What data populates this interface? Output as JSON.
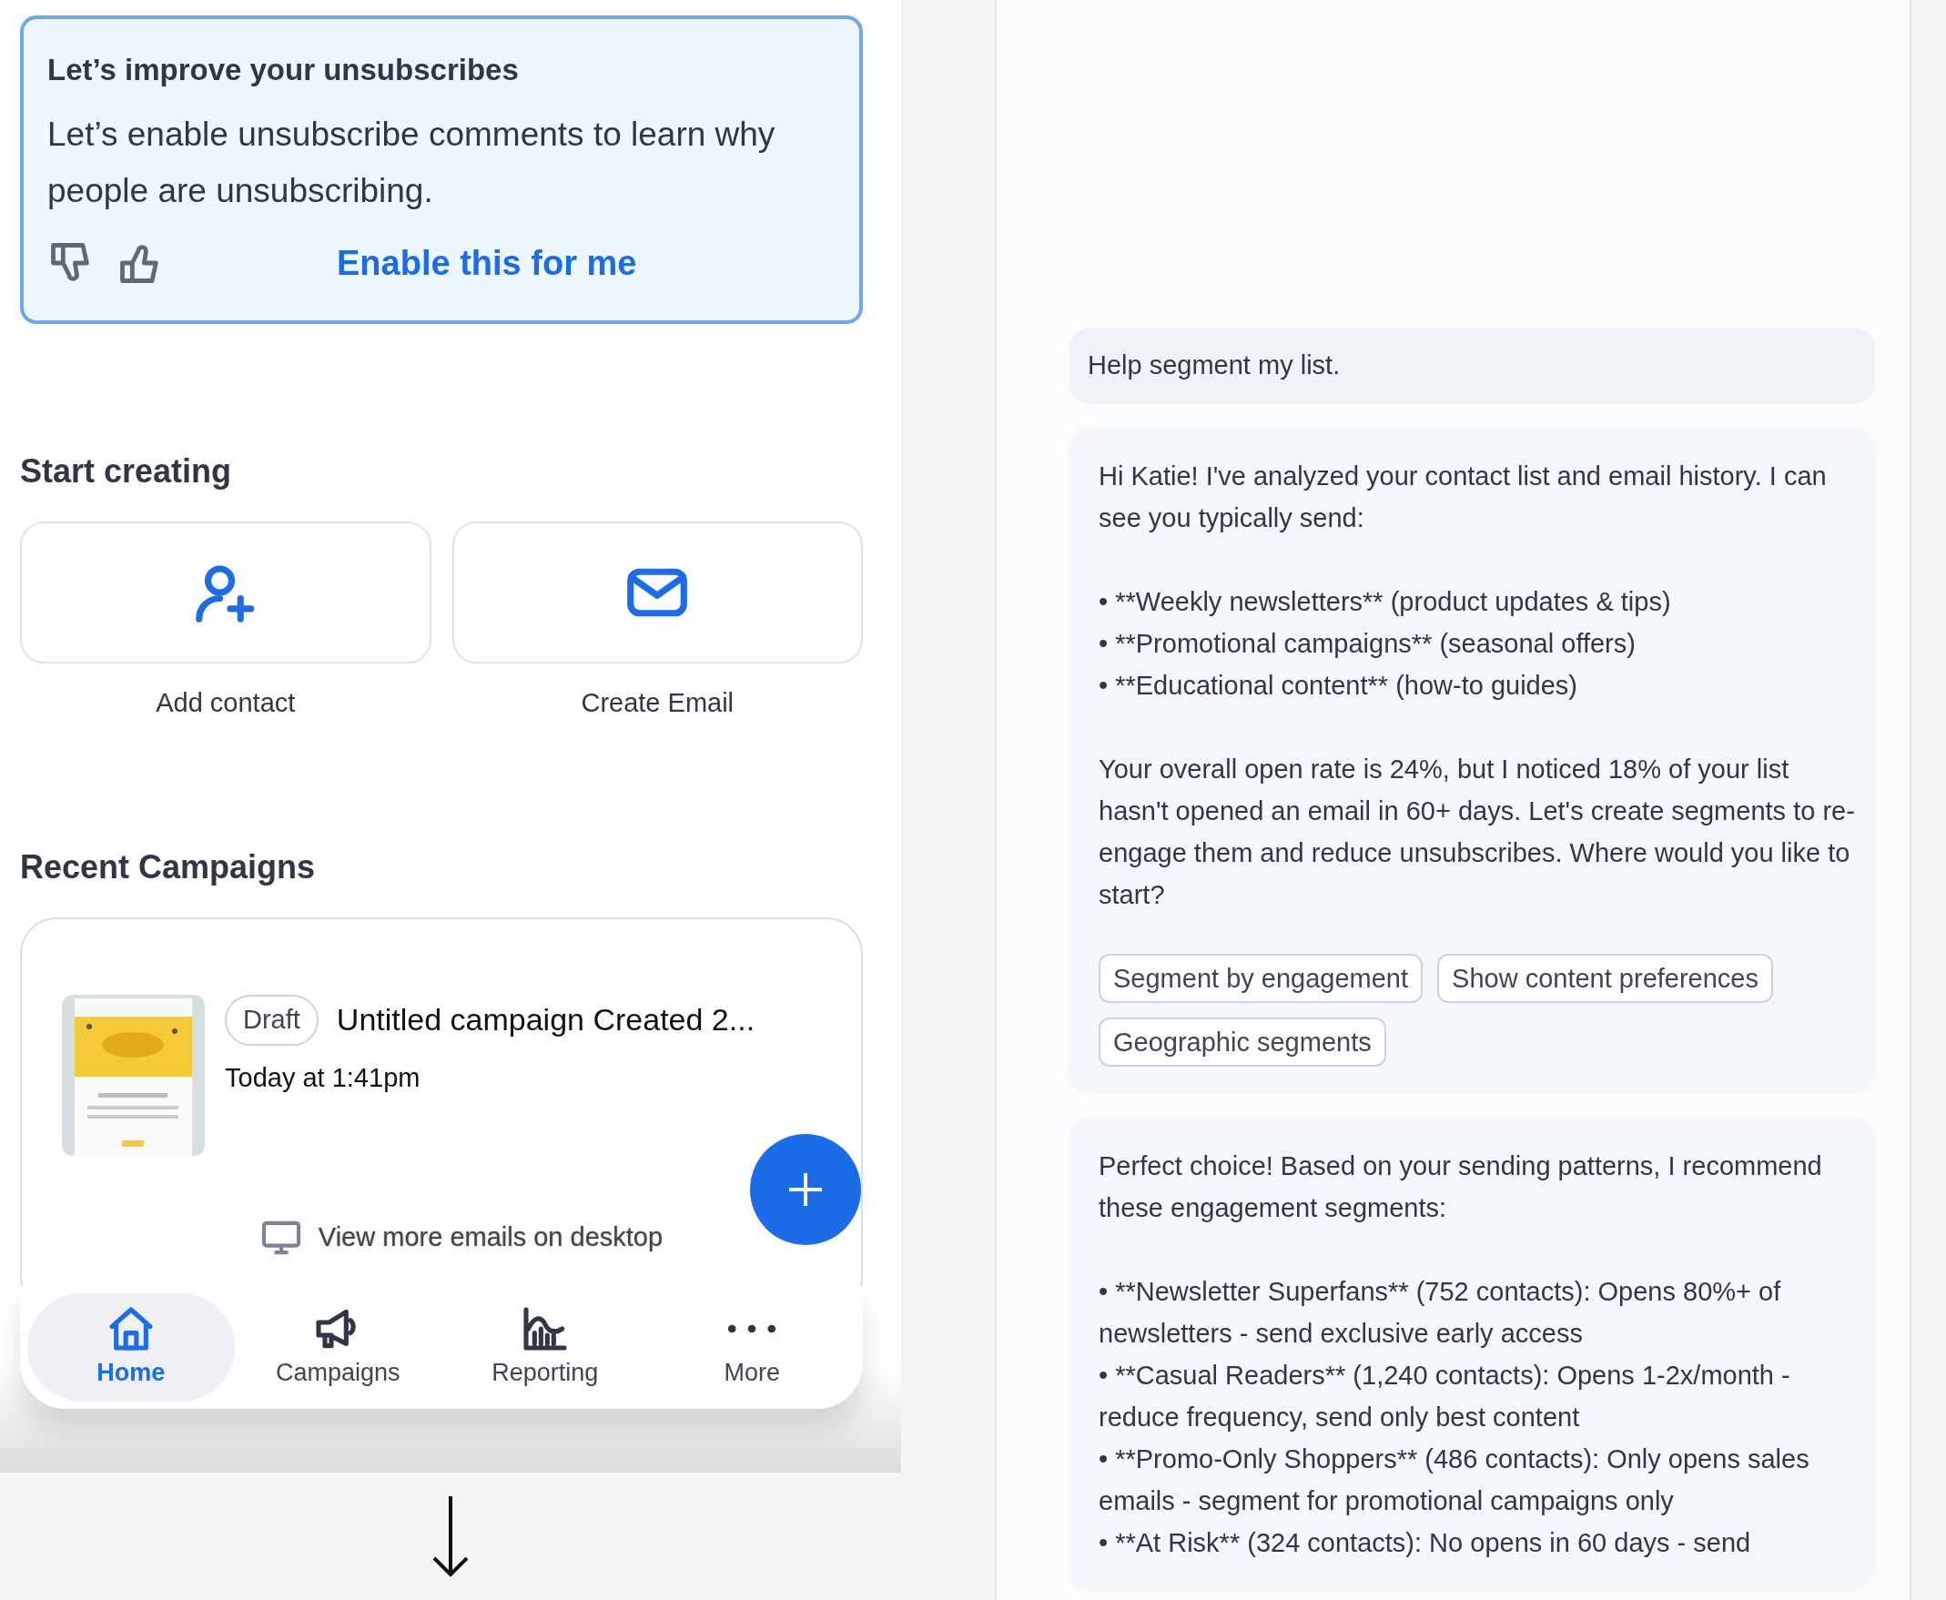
{
  "tip_card": {
    "title": "Let’s improve your unsubscribes",
    "body": "Let’s enable unsubscribe comments to learn why people are unsubscribing.",
    "action": "Enable this for me"
  },
  "start_creating": {
    "heading": "Start creating",
    "tiles": [
      {
        "kind": "contact",
        "label": "Add contact"
      },
      {
        "kind": "email",
        "label": "Create Email"
      }
    ]
  },
  "recent_campaigns": {
    "heading": "Recent Campaigns",
    "campaigns": [
      {
        "status": "Draft",
        "name": "Untitled campaign Created 2...",
        "time": "Today at 1:41pm"
      }
    ],
    "desktop_link": "View more emails on desktop"
  },
  "bottom_nav": [
    {
      "kind": "home",
      "label": "Home",
      "selected": true
    },
    {
      "kind": "megaphone",
      "label": "Campaigns",
      "selected": false
    },
    {
      "kind": "chart",
      "label": "Reporting",
      "selected": false
    },
    {
      "kind": "dots",
      "label": "More",
      "selected": false
    }
  ],
  "chat": [
    {
      "kind": "user",
      "paragraphs": [
        {
          "text": "Help segment my list."
        }
      ]
    },
    {
      "kind": "assistant",
      "paragraphs": [
        {
          "text": "Hi Katie! I've analyzed your contact list and email history. I can see you typically send:"
        },
        {
          "bullets": [
            "• **Weekly newsletters** (product updates & tips)",
            "• **Promotional campaigns** (seasonal offers)",
            "• **Educational content** (how-to guides)"
          ]
        },
        {
          "text": "Your overall open rate is 24%, but I noticed 18% of your list hasn't opened an email in 60+ days. Let's create segments to re-engage them and reduce unsubscribes. Where would you like to start?"
        }
      ],
      "chips": [
        "Segment by engagement",
        "Show content preferences",
        "Geographic segments"
      ]
    },
    {
      "kind": "assistant",
      "paragraphs": [
        {
          "text": "Perfect choice! Based on your sending patterns, I recommend these engagement segments:"
        },
        {
          "bullets": [
            "• **Newsletter Superfans** (752 contacts): Opens 80%+ of newsletters - send exclusive early access",
            "• **Casual Readers** (1,240 contacts): Opens 1-2x/month - reduce frequency, send only best content",
            "• **Promo-Only Shoppers** (486 contacts): Only opens sales emails - segment for promotional campaigns only",
            "• **At Risk** (324 contacts): No opens in 60 days - send"
          ]
        }
      ]
    }
  ]
}
